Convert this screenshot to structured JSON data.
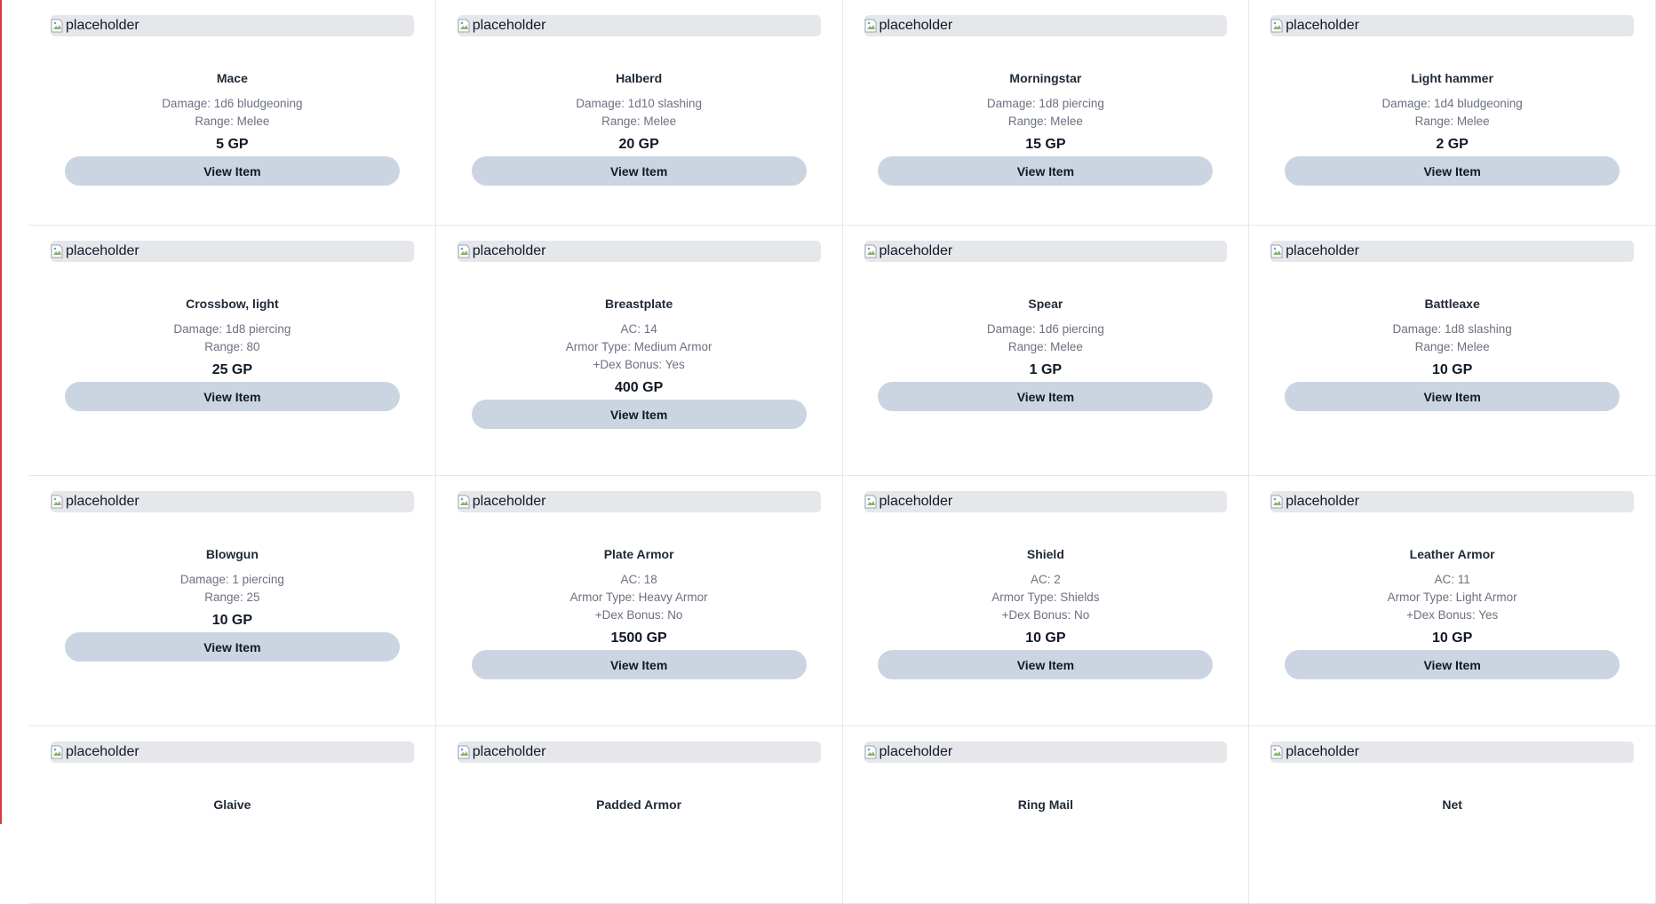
{
  "items": [
    {
      "name": "Mace",
      "stats": [
        "Damage: 1d6 bludgeoning",
        "Range: Melee"
      ],
      "price": "5 GP",
      "image_alt": "placeholder",
      "button": "View Item"
    },
    {
      "name": "Halberd",
      "stats": [
        "Damage: 1d10 slashing",
        "Range: Melee"
      ],
      "price": "20 GP",
      "image_alt": "placeholder",
      "button": "View Item"
    },
    {
      "name": "Morningstar",
      "stats": [
        "Damage: 1d8 piercing",
        "Range: Melee"
      ],
      "price": "15 GP",
      "image_alt": "placeholder",
      "button": "View Item"
    },
    {
      "name": "Light hammer",
      "stats": [
        "Damage: 1d4 bludgeoning",
        "Range: Melee"
      ],
      "price": "2 GP",
      "image_alt": "placeholder",
      "button": "View Item"
    },
    {
      "name": "Crossbow, light",
      "stats": [
        "Damage: 1d8 piercing",
        "Range: 80"
      ],
      "price": "25 GP",
      "image_alt": "placeholder",
      "button": "View Item"
    },
    {
      "name": "Breastplate",
      "stats": [
        "AC: 14",
        "Armor Type: Medium Armor",
        "+Dex Bonus: Yes"
      ],
      "price": "400 GP",
      "image_alt": "placeholder",
      "button": "View Item"
    },
    {
      "name": "Spear",
      "stats": [
        "Damage: 1d6 piercing",
        "Range: Melee"
      ],
      "price": "1 GP",
      "image_alt": "placeholder",
      "button": "View Item"
    },
    {
      "name": "Battleaxe",
      "stats": [
        "Damage: 1d8 slashing",
        "Range: Melee"
      ],
      "price": "10 GP",
      "image_alt": "placeholder",
      "button": "View Item"
    },
    {
      "name": "Blowgun",
      "stats": [
        "Damage: 1 piercing",
        "Range: 25"
      ],
      "price": "10 GP",
      "image_alt": "placeholder",
      "button": "View Item"
    },
    {
      "name": "Plate Armor",
      "stats": [
        "AC: 18",
        "Armor Type: Heavy Armor",
        "+Dex Bonus: No"
      ],
      "price": "1500 GP",
      "image_alt": "placeholder",
      "button": "View Item"
    },
    {
      "name": "Shield",
      "stats": [
        "AC: 2",
        "Armor Type: Shields",
        "+Dex Bonus: No"
      ],
      "price": "10 GP",
      "image_alt": "placeholder",
      "button": "View Item"
    },
    {
      "name": "Leather Armor",
      "stats": [
        "AC: 11",
        "Armor Type: Light Armor",
        "+Dex Bonus: Yes"
      ],
      "price": "10 GP",
      "image_alt": "placeholder",
      "button": "View Item"
    },
    {
      "name": "Glaive",
      "stats": [],
      "price": "",
      "image_alt": "placeholder",
      "button": ""
    },
    {
      "name": "Padded Armor",
      "stats": [],
      "price": "",
      "image_alt": "placeholder",
      "button": ""
    },
    {
      "name": "Ring Mail",
      "stats": [],
      "price": "",
      "image_alt": "placeholder",
      "button": ""
    },
    {
      "name": "Net",
      "stats": [],
      "price": "",
      "image_alt": "placeholder",
      "button": ""
    }
  ],
  "colors": {
    "button_bg": "#cbd5e1",
    "image_bg": "#e5e7eb",
    "left_edge": "#dc3545",
    "stat_text": "#6b7280"
  },
  "icons": {
    "broken_image": "broken-image-icon"
  }
}
